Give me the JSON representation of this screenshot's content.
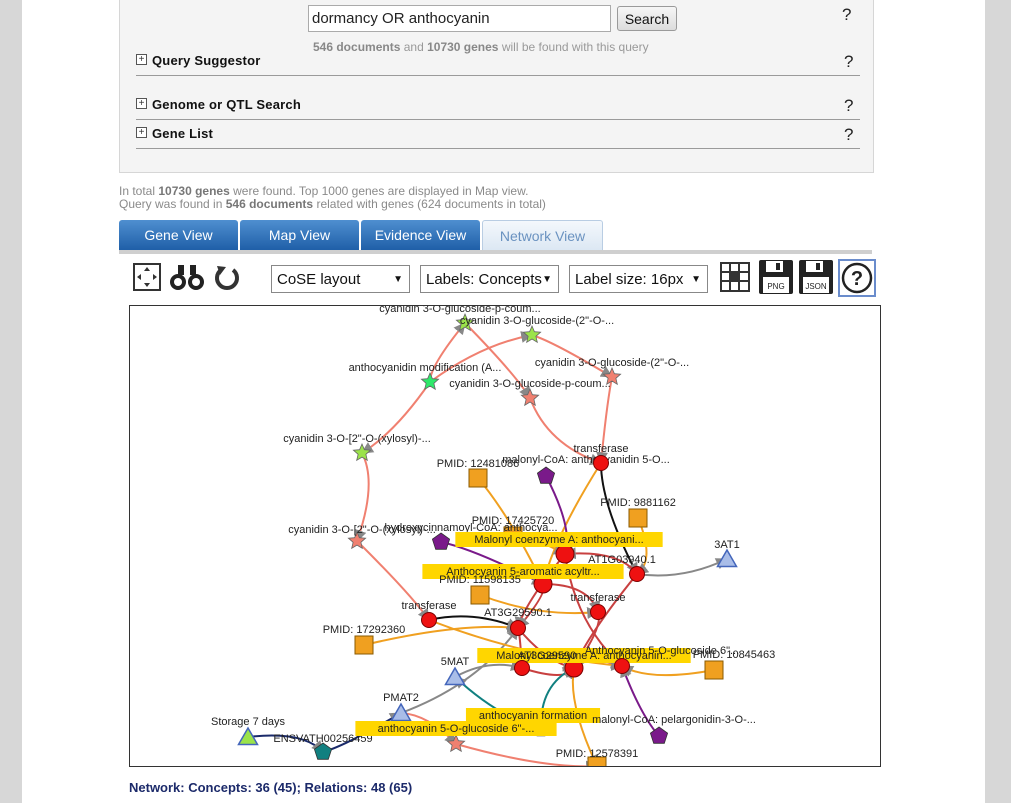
{
  "search": {
    "query": "dormancy OR anthocyanin",
    "button": "Search",
    "docs": "546 documents",
    "and_text": "and",
    "genes": "10730 genes",
    "tail_text": "will be found with this query"
  },
  "sections": [
    {
      "label": "Query Suggestor"
    },
    {
      "label": "Genome or QTL Search"
    },
    {
      "label": "Gene List"
    }
  ],
  "help_mark": "?",
  "summary": {
    "l1_a": "In total",
    "l1_b": "10730 genes",
    "l1_c": "were found. Top 1000 genes are displayed in Map view.",
    "l2_a": "Query was found in",
    "l2_b": "546 documents",
    "l2_c": "related with genes (624 documents in total)"
  },
  "tabs": [
    {
      "label": "Gene View"
    },
    {
      "label": "Map View"
    },
    {
      "label": "Evidence View"
    },
    {
      "label": "Network View",
      "active": true
    }
  ],
  "toolbar": {
    "layout": "CoSE layout",
    "labels": "Labels: Concepts",
    "label_size": "Label size: 16px",
    "png": "PNG",
    "json": "JSON"
  },
  "network": {
    "nodes": [
      {
        "id": "c1",
        "label": "cyanidin 3-O-glucoside-p-coum...",
        "shape": "star",
        "color": "#9be34a"
      },
      {
        "id": "c2",
        "label": "cyanidin 3-O-glucoside-(2\"-O-...",
        "shape": "star",
        "color": "#9be34a"
      },
      {
        "id": "c3",
        "label": "anthocyanidin modification (A...",
        "shape": "star",
        "color": "#2ee86a"
      },
      {
        "id": "c4",
        "label": "cyanidin 3-O-glucoside-(2\"-O-...",
        "shape": "star",
        "color": "#f08070"
      },
      {
        "id": "c5",
        "label": "cyanidin 3-O-glucoside-p-coum...",
        "shape": "star",
        "color": "#f08070"
      },
      {
        "id": "c6",
        "label": "cyanidin 3-O-[2\"-O-(xylosyl)-...",
        "shape": "star",
        "color": "#9be34a"
      },
      {
        "id": "c7",
        "label": "cyanidin 3-O-[2\"-O-(xylosyl)-...",
        "shape": "star",
        "color": "#f08070"
      },
      {
        "id": "p1",
        "label": "PMID: 12481086",
        "shape": "square",
        "color": "#f0a020"
      },
      {
        "id": "mal1",
        "label": "malonyl-CoA: anthocyanidin 5-O...",
        "shape": "pentagon",
        "color": "#7a1a8a"
      },
      {
        "id": "t1",
        "label": "transferase",
        "shape": "circle",
        "color": "#ee1111"
      },
      {
        "id": "p2",
        "label": "PMID: 9881162",
        "shape": "square",
        "color": "#f0a020"
      },
      {
        "id": "p3",
        "label": "PMID: 17425720",
        "shape": "square",
        "color": "#f0a020"
      },
      {
        "id": "hc",
        "label": "hydroxycinnamoyl-CoA: anthocya...",
        "shape": "pentagon",
        "color": "#7a1a8a"
      },
      {
        "id": "mc",
        "label": "Malonyl coenzyme A: anthocyani...",
        "shape": "circle",
        "color": "#ee1111",
        "box": true
      },
      {
        "id": "at",
        "label": "AT1G03940.1",
        "shape": "circle",
        "color": "#ee1111"
      },
      {
        "id": "a3",
        "label": "3AT1",
        "shape": "triangle",
        "color": "#a9bde8"
      },
      {
        "id": "a5",
        "label": "Anthocyanin 5-aromatic acyltr...",
        "shape": "circle",
        "color": "#ee1111",
        "box": true
      },
      {
        "id": "p4",
        "label": "PMID: 11598135",
        "shape": "square",
        "color": "#f0a020"
      },
      {
        "id": "t2",
        "label": "transferase",
        "shape": "circle",
        "color": "#ee1111"
      },
      {
        "id": "t3",
        "label": "transferase",
        "shape": "circle",
        "color": "#ee1111"
      },
      {
        "id": "at3",
        "label": "AT3G29590.1",
        "shape": "circle",
        "color": "#ee1111"
      },
      {
        "id": "p5",
        "label": "PMID: 17292360",
        "shape": "square",
        "color": "#f0a020"
      },
      {
        "id": "mc2",
        "label": "Malonyl coenzyme A: anthocyanin...",
        "shape": "circle",
        "color": "#ee1111",
        "box": true
      },
      {
        "id": "at3b",
        "label": "AT3G29590",
        "shape": "circle",
        "color": "#ee1111"
      },
      {
        "id": "ao",
        "label": "Anthocyanin 5-O-glucoside 6\"...",
        "shape": "circle",
        "color": "#ee1111"
      },
      {
        "id": "p6",
        "label": "PMID: 10845463",
        "shape": "square",
        "color": "#f0a020"
      },
      {
        "id": "m5",
        "label": "5MAT",
        "shape": "triangle",
        "color": "#a9bde8"
      },
      {
        "id": "pm2",
        "label": "PMAT2",
        "shape": "triangle",
        "color": "#a9bde8"
      },
      {
        "id": "af",
        "label": "anthocyanin formation",
        "shape": "hexagon",
        "color": "#118080",
        "box": true
      },
      {
        "id": "mp",
        "label": "malonyl-CoA: pelargonidin-3-O-...",
        "shape": "pentagon",
        "color": "#7a1a8a"
      },
      {
        "id": "st",
        "label": "Storage 7 days",
        "shape": "triangle",
        "color": "#9be34a"
      },
      {
        "id": "en",
        "label": "ENSVATH00256459",
        "shape": "pentagon",
        "color": "#118080"
      },
      {
        "id": "a56",
        "label": "anthocyanin 5-O-glucoside 6\"-...",
        "shape": "star",
        "color": "#f08070",
        "box": true
      },
      {
        "id": "p7",
        "label": "PMID: 12578391",
        "shape": "square",
        "color": "#f0a020"
      }
    ]
  },
  "footer": {
    "label": "Network: Concepts: 36 (45); Relations: 48 (65)"
  }
}
